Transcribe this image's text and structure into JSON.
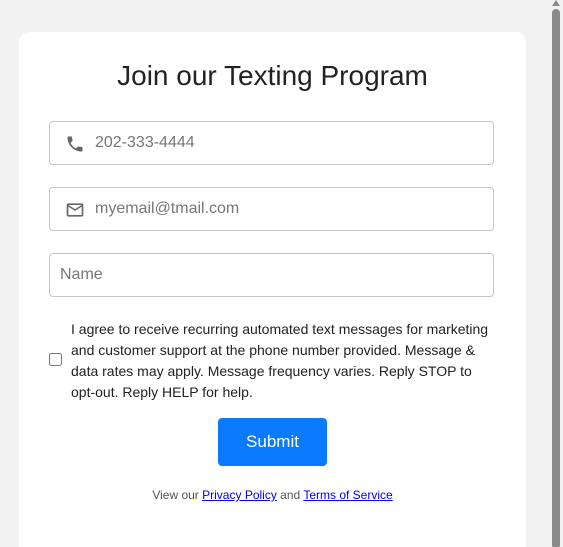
{
  "form": {
    "title": "Join our Texting Program",
    "phone": {
      "placeholder": "202-333-4444",
      "icon": "phone-icon"
    },
    "email": {
      "placeholder": "myemail@tmail.com",
      "icon": "mail-icon"
    },
    "name": {
      "placeholder": "Name"
    },
    "consent": {
      "checked": false,
      "text": "I agree to receive recurring automated text messages for marketing and customer support at the phone number provided. Message & data rates may apply. Message frequency varies. Reply STOP to opt-out. Reply HELP for help."
    },
    "submit_label": "Submit",
    "footer": {
      "prefix": "View our ",
      "privacy_label": "Privacy Policy",
      "conjunction": " and ",
      "terms_label": "Terms of Service"
    }
  },
  "colors": {
    "background": "#f2f2f2",
    "card": "#ffffff",
    "accent": "#0a7aff",
    "link": "#0000ee"
  }
}
